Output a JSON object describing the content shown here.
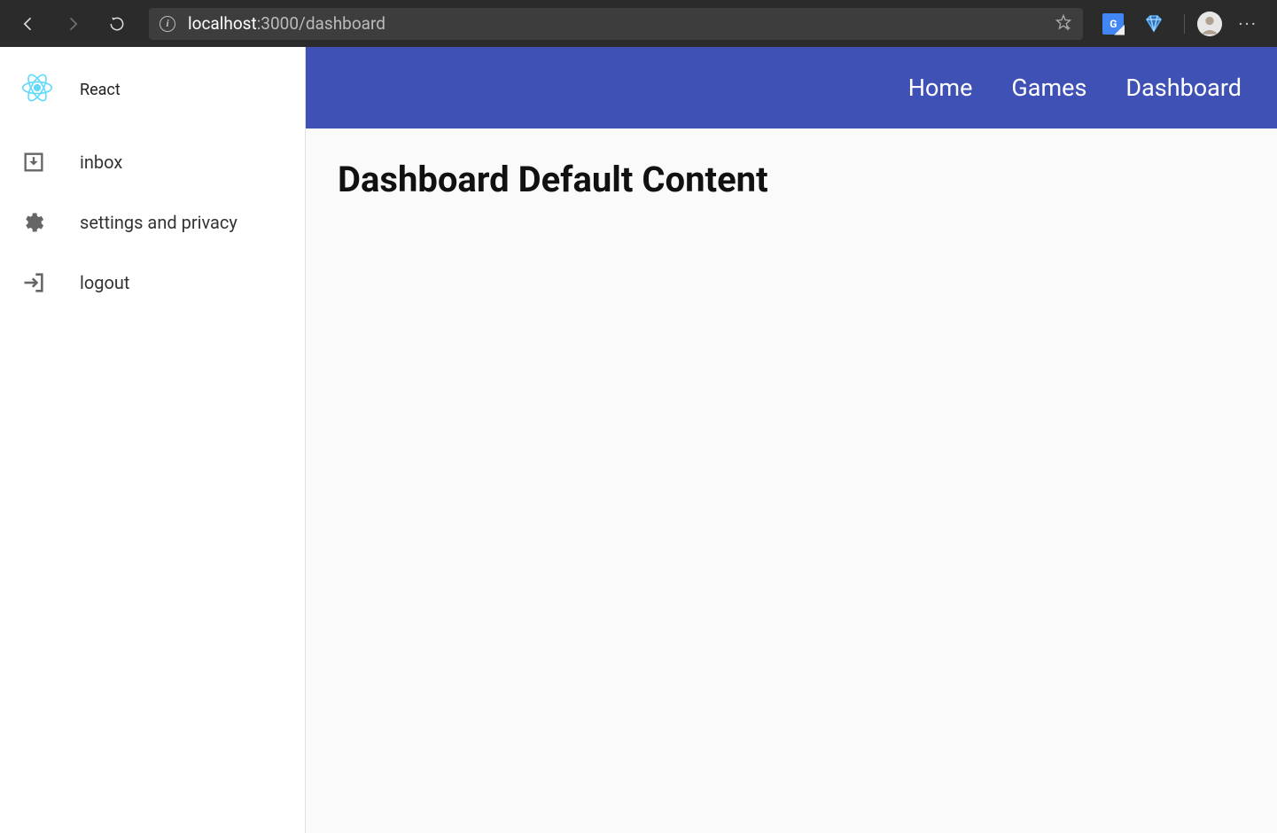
{
  "browser": {
    "url_host": "localhost",
    "url_rest": ":3000/dashboard"
  },
  "sidebar": {
    "title": "React",
    "items": [
      {
        "icon": "inbox-icon",
        "label": "inbox"
      },
      {
        "icon": "settings-icon",
        "label": "settings and privacy"
      },
      {
        "icon": "logout-icon",
        "label": "logout"
      }
    ]
  },
  "topnav": {
    "links": [
      "Home",
      "Games",
      "Dashboard"
    ]
  },
  "content": {
    "heading": "Dashboard Default Content"
  },
  "colors": {
    "primary": "#3f51b5",
    "browser_bar": "#2b2b2b",
    "react_logo": "#61dafb"
  }
}
